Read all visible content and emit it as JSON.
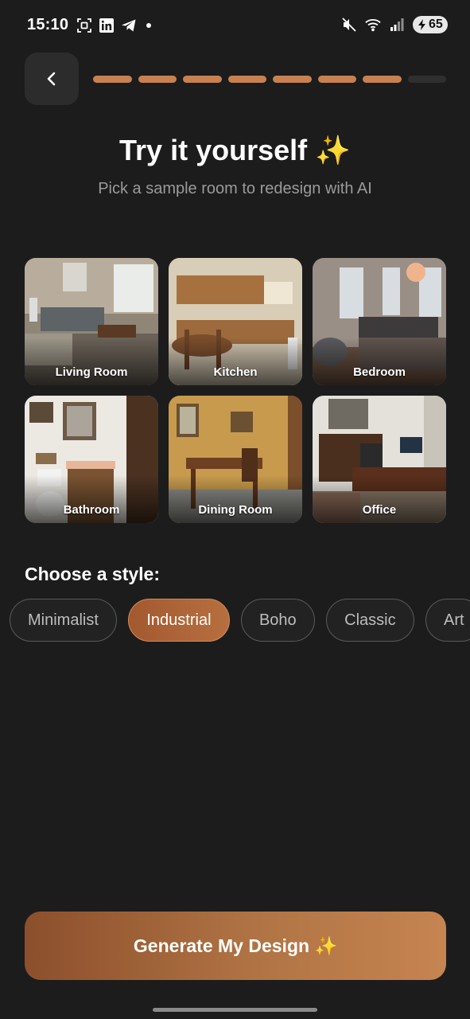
{
  "status_bar": {
    "time": "15:10",
    "battery": "65",
    "left_icons": [
      "screenshot-icon",
      "linkedin-icon",
      "telegram-icon"
    ],
    "right_icons": [
      "mute-icon",
      "wifi-icon",
      "signal-icon"
    ]
  },
  "nav": {
    "back_icon": "chevron-left-icon",
    "progress_total_steps": 8,
    "progress_completed_steps": 7
  },
  "header": {
    "title": "Try it yourself ✨",
    "subtitle": "Pick a sample room to redesign with AI"
  },
  "rooms": [
    {
      "label": "Living Room",
      "selected": false
    },
    {
      "label": "Kitchen",
      "selected": true
    },
    {
      "label": "Bedroom",
      "selected": false
    },
    {
      "label": "Bathroom",
      "selected": false
    },
    {
      "label": "Dining Room",
      "selected": false
    },
    {
      "label": "Office",
      "selected": false
    }
  ],
  "style_section": {
    "heading": "Choose a style:",
    "styles": [
      "Minimalist",
      "Industrial",
      "Boho",
      "Classic",
      "Art"
    ],
    "selected": "Industrial"
  },
  "cta": {
    "label": "Generate My Design ✨"
  },
  "colors": {
    "background": "#1c1c1c",
    "accent": "#c78150",
    "accent_dark": "#8c4f2c",
    "muted_text": "#9a9a9a"
  }
}
